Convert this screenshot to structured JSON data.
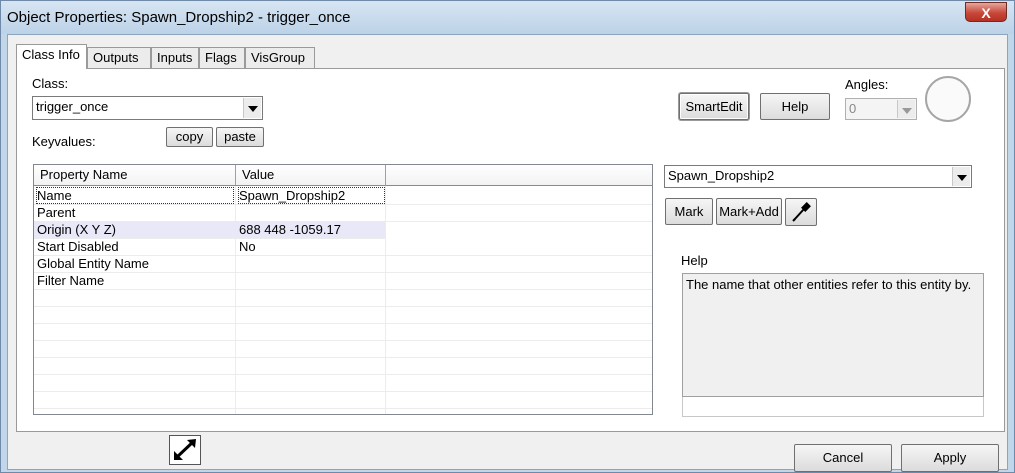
{
  "window": {
    "title": "Object Properties: Spawn_Dropship2 - trigger_once",
    "close_label": "X"
  },
  "tabs": [
    {
      "label": "Class Info",
      "active": true
    },
    {
      "label": "Outputs"
    },
    {
      "label": "Inputs"
    },
    {
      "label": "Flags"
    },
    {
      "label": "VisGroup"
    }
  ],
  "class_info": {
    "class_label": "Class:",
    "class_value": "trigger_once",
    "keyvalues_label": "Keyvalues:",
    "copy_label": "copy",
    "paste_label": "paste",
    "smartedit_label": "SmartEdit",
    "help_button_label": "Help",
    "angles_label": "Angles:",
    "angles_value": "0"
  },
  "table": {
    "columns": [
      "Property Name",
      "Value"
    ],
    "rows": [
      {
        "name": "Name",
        "value": "Spawn_Dropship2"
      },
      {
        "name": "Parent",
        "value": ""
      },
      {
        "name": "Origin (X Y Z)",
        "value": "688 448 -1059.17"
      },
      {
        "name": "Start Disabled",
        "value": "No"
      },
      {
        "name": "Global Entity Name",
        "value": ""
      },
      {
        "name": "Filter Name",
        "value": ""
      }
    ]
  },
  "right_panel": {
    "value_combo": "Spawn_Dropship2",
    "mark_label": "Mark",
    "mark_add_label": "Mark+Add",
    "help_heading": "Help",
    "help_text": "The name that other entities refer to this entity by."
  },
  "footer": {
    "cancel_label": "Cancel",
    "apply_label": "Apply"
  },
  "colors": {
    "selection_row": "#e8e8f8",
    "title_bar": "#c2d6ea",
    "close_button": "#c8483a"
  }
}
